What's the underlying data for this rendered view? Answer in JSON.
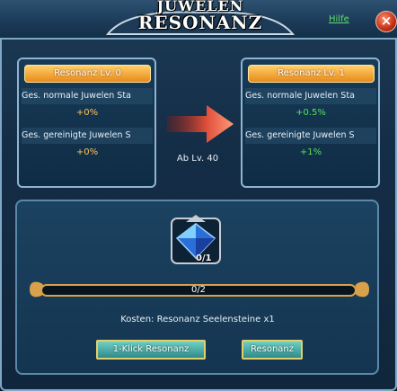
{
  "window": {
    "title_line1": "JUWELEN",
    "title_line2": "RESONANZ",
    "help_label": "Hilfe",
    "close_label": "×"
  },
  "current": {
    "level_label": "Resonanz Lv. 0",
    "stat1_label": "Ges. normale Juwelen Sta",
    "stat1_value": "+0%",
    "stat2_label": "Ges. gereinigte Juwelen S",
    "stat2_value": "+0%"
  },
  "next": {
    "level_label": "Resonanz Lv. 1",
    "stat1_label": "Ges. normale Juwelen Sta",
    "stat1_value": "+0.5%",
    "stat2_label": "Ges. gereinigte Juwelen S",
    "stat2_value": "+1%"
  },
  "requirement": "Ab Lv. 40",
  "material": {
    "count": "0/1",
    "icon": "blue-gem-icon"
  },
  "progress": {
    "text": "0/2",
    "current": 0,
    "max": 2
  },
  "cost_text": "Kosten: Resonanz Seelensteine x1",
  "buttons": {
    "one_click": "1-Klick Resonanz",
    "resonance": "Resonanz"
  },
  "colors": {
    "value_orange": "#ffc35a",
    "value_green": "#57e05a",
    "level_badge": "#f0a030"
  }
}
